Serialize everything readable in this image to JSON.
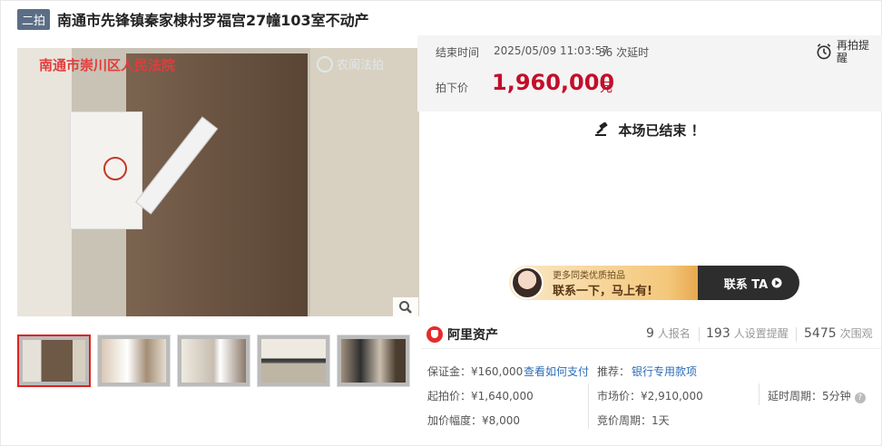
{
  "header": {
    "badge": "二拍",
    "title": "南通市先锋镇秦家棣村罗福宫27幢103室不动产"
  },
  "photo": {
    "watermark_court": "南通市崇川区人民法院",
    "watermark_brand": "农阆法拍",
    "zoom_icon": "magnifier-icon"
  },
  "thumbnails": [
    {
      "name": "thumb-1",
      "active": true
    },
    {
      "name": "thumb-2",
      "active": false
    },
    {
      "name": "thumb-3",
      "active": false
    },
    {
      "name": "thumb-4",
      "active": false
    },
    {
      "name": "thumb-5",
      "active": false
    }
  ],
  "auction": {
    "end_label": "结束时间",
    "end_time": "2025/05/09 11:03:57",
    "delay": "36 次延时",
    "price_label": "拍下价",
    "price": "1,960,000",
    "price_unit": "元",
    "remind_label": "再拍提醒",
    "ended_text": "本场已结束 ！"
  },
  "banner": {
    "small": "更多同类优质拍品",
    "big": "联系一下，马上有!",
    "cta": "联系 TA"
  },
  "stats": {
    "brand": "阿里资产",
    "signups_num": "9",
    "signups_label": "人报名",
    "reminders_num": "193",
    "reminders_label": "人设置提醒",
    "views_num": "5475",
    "views_label": "次围观"
  },
  "details": {
    "deposit": "保证金：¥160,000",
    "deposit_link": "查看如何支付",
    "recommend_label": "推荐：",
    "recommend_link": "银行专用款项",
    "start_price": "起拍价：¥1,640,000",
    "market_price": "市场价：¥2,910,000",
    "delay_period": "延时周期：5分钟",
    "increment": "加价幅度：¥8,000",
    "bid_period": "竞价周期：1天"
  },
  "colors": {
    "accent": "#c40e2a",
    "link": "#2d6db5",
    "badge": "#5b6e86"
  }
}
